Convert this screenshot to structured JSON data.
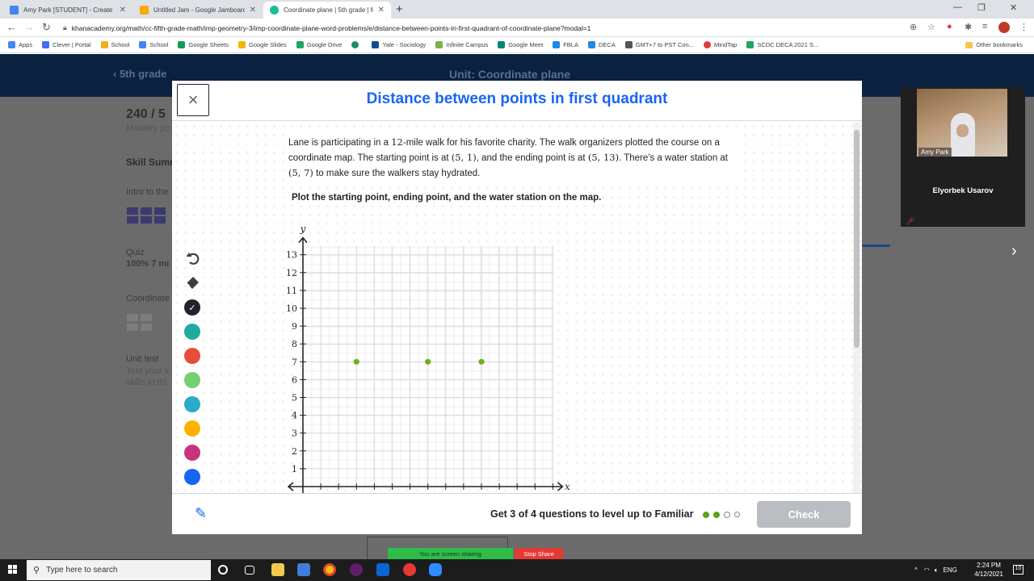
{
  "browser": {
    "tabs": [
      {
        "title": "Amy Park [STUDENT] - Create PT",
        "icon": "docs-icon",
        "color": "#4285f4"
      },
      {
        "title": "Untitled Jam - Google Jamboard",
        "icon": "jamboard-icon",
        "color": "#f9ab00"
      },
      {
        "title": "Coordinate plane | 5th grade | M",
        "icon": "khan-academy-icon",
        "color": "#14bf96"
      }
    ],
    "url": "khanacademy.org/math/cc-fifth-grade-math/imp-geometry-3/imp-coordinate-plane-word-problems/e/distance-between-points-in-first-quadrant-of-coordinate-plane?modal=1",
    "bookmarks": [
      {
        "label": "Apps",
        "color": "#4285f4"
      },
      {
        "label": "Clever | Portal",
        "color": "#436cf2"
      },
      {
        "label": "School",
        "color": "#f2b01e"
      },
      {
        "label": "School",
        "color": "#4285f4"
      },
      {
        "label": "Google Sheets",
        "color": "#0f9d58"
      },
      {
        "label": "Google Slides",
        "color": "#f4b400"
      },
      {
        "label": "Google Drive",
        "color": "#1fa463"
      },
      {
        "label": "",
        "color": "#1f8a70"
      },
      {
        "label": "Yale - Sociology",
        "color": "#0f4d92"
      },
      {
        "label": "Infinite Campus",
        "color": "#7cb342"
      },
      {
        "label": "Google Meet",
        "color": "#00897b"
      },
      {
        "label": "FBLA",
        "color": "#1e88e5"
      },
      {
        "label": "DECA",
        "color": "#1e88e5"
      },
      {
        "label": "GMT+7 to PST Con...",
        "color": "#555555"
      },
      {
        "label": "MindTap",
        "color": "#e53935"
      },
      {
        "label": "SCDC DECA 2021 S...",
        "color": "#1fa463"
      }
    ],
    "other_bookmarks": "Other bookmarks"
  },
  "page": {
    "back_label": "5th grade",
    "unit_title": "Unit: Coordinate plane",
    "score": "240 / 5",
    "mastery": "Mastery po",
    "skill_summary": "Skill Sumn",
    "intro": "Intro to the",
    "quiz": "Quiz",
    "quiz_score": "100% 7 mi",
    "coordinate": "Coordinate",
    "unit_test": "Unit test",
    "unit_test_desc1": "Test your k",
    "unit_test_desc2": "skills in thi"
  },
  "modal": {
    "title": "Distance between points in first quadrant",
    "question": {
      "p1": "Lane is participating in a ",
      "m1": "12",
      "p2": "-mile walk for his favorite charity. The walk organizers plotted the course on a coordinate map. The starting point is at ",
      "m2": "(5, 1)",
      "p3": ", and the ending point is at ",
      "m3": "(5, 13)",
      "p4": ". There's a water station at ",
      "m4": "(5, 7)",
      "p5": " to make sure the walkers stay hydrated."
    },
    "instruction": "Plot the starting point, ending point, and the water station on the map.",
    "tool_colors": [
      "#21242c",
      "#1fab9f",
      "#e84d39",
      "#74cf70",
      "#29abca",
      "#ffb100",
      "#ca337c",
      "#1865f2"
    ],
    "footer": {
      "progress": "Get 3 of 4 questions to level up to Familiar",
      "dots": [
        "filled",
        "filled",
        "empty",
        "empty"
      ],
      "check": "Check"
    }
  },
  "chart_data": {
    "type": "scatter",
    "xlabel": "x",
    "ylabel": "y",
    "xlim": [
      0,
      14
    ],
    "ylim": [
      0,
      13.5
    ],
    "y_ticks": [
      1,
      2,
      3,
      4,
      5,
      6,
      7,
      8,
      9,
      10,
      11,
      12,
      13
    ],
    "series": [
      {
        "points": [
          [
            3,
            7
          ],
          [
            7,
            7
          ],
          [
            10,
            7
          ]
        ],
        "color": "#6bb21e"
      }
    ]
  },
  "video": {
    "self_name": "Amy Park",
    "other_name": "Elyorbek Usarov"
  },
  "share": {
    "sharing": "You are screen sharing",
    "stop": "Stop Share"
  },
  "taskbar": {
    "search_placeholder": "Type here to search",
    "lang": "ENG",
    "time": "2:24 PM",
    "date": "4/12/2021",
    "notifications": "10"
  }
}
